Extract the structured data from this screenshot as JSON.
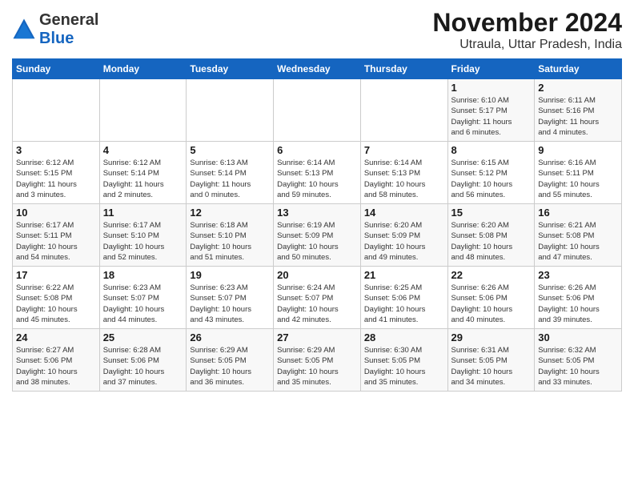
{
  "header": {
    "logo_general": "General",
    "logo_blue": "Blue",
    "month_title": "November 2024",
    "subtitle": "Utraula, Uttar Pradesh, India"
  },
  "calendar": {
    "days_of_week": [
      "Sunday",
      "Monday",
      "Tuesday",
      "Wednesday",
      "Thursday",
      "Friday",
      "Saturday"
    ],
    "weeks": [
      [
        {
          "day": "",
          "info": ""
        },
        {
          "day": "",
          "info": ""
        },
        {
          "day": "",
          "info": ""
        },
        {
          "day": "",
          "info": ""
        },
        {
          "day": "",
          "info": ""
        },
        {
          "day": "1",
          "info": "Sunrise: 6:10 AM\nSunset: 5:17 PM\nDaylight: 11 hours\nand 6 minutes."
        },
        {
          "day": "2",
          "info": "Sunrise: 6:11 AM\nSunset: 5:16 PM\nDaylight: 11 hours\nand 4 minutes."
        }
      ],
      [
        {
          "day": "3",
          "info": "Sunrise: 6:12 AM\nSunset: 5:15 PM\nDaylight: 11 hours\nand 3 minutes."
        },
        {
          "day": "4",
          "info": "Sunrise: 6:12 AM\nSunset: 5:14 PM\nDaylight: 11 hours\nand 2 minutes."
        },
        {
          "day": "5",
          "info": "Sunrise: 6:13 AM\nSunset: 5:14 PM\nDaylight: 11 hours\nand 0 minutes."
        },
        {
          "day": "6",
          "info": "Sunrise: 6:14 AM\nSunset: 5:13 PM\nDaylight: 10 hours\nand 59 minutes."
        },
        {
          "day": "7",
          "info": "Sunrise: 6:14 AM\nSunset: 5:13 PM\nDaylight: 10 hours\nand 58 minutes."
        },
        {
          "day": "8",
          "info": "Sunrise: 6:15 AM\nSunset: 5:12 PM\nDaylight: 10 hours\nand 56 minutes."
        },
        {
          "day": "9",
          "info": "Sunrise: 6:16 AM\nSunset: 5:11 PM\nDaylight: 10 hours\nand 55 minutes."
        }
      ],
      [
        {
          "day": "10",
          "info": "Sunrise: 6:17 AM\nSunset: 5:11 PM\nDaylight: 10 hours\nand 54 minutes."
        },
        {
          "day": "11",
          "info": "Sunrise: 6:17 AM\nSunset: 5:10 PM\nDaylight: 10 hours\nand 52 minutes."
        },
        {
          "day": "12",
          "info": "Sunrise: 6:18 AM\nSunset: 5:10 PM\nDaylight: 10 hours\nand 51 minutes."
        },
        {
          "day": "13",
          "info": "Sunrise: 6:19 AM\nSunset: 5:09 PM\nDaylight: 10 hours\nand 50 minutes."
        },
        {
          "day": "14",
          "info": "Sunrise: 6:20 AM\nSunset: 5:09 PM\nDaylight: 10 hours\nand 49 minutes."
        },
        {
          "day": "15",
          "info": "Sunrise: 6:20 AM\nSunset: 5:08 PM\nDaylight: 10 hours\nand 48 minutes."
        },
        {
          "day": "16",
          "info": "Sunrise: 6:21 AM\nSunset: 5:08 PM\nDaylight: 10 hours\nand 47 minutes."
        }
      ],
      [
        {
          "day": "17",
          "info": "Sunrise: 6:22 AM\nSunset: 5:08 PM\nDaylight: 10 hours\nand 45 minutes."
        },
        {
          "day": "18",
          "info": "Sunrise: 6:23 AM\nSunset: 5:07 PM\nDaylight: 10 hours\nand 44 minutes."
        },
        {
          "day": "19",
          "info": "Sunrise: 6:23 AM\nSunset: 5:07 PM\nDaylight: 10 hours\nand 43 minutes."
        },
        {
          "day": "20",
          "info": "Sunrise: 6:24 AM\nSunset: 5:07 PM\nDaylight: 10 hours\nand 42 minutes."
        },
        {
          "day": "21",
          "info": "Sunrise: 6:25 AM\nSunset: 5:06 PM\nDaylight: 10 hours\nand 41 minutes."
        },
        {
          "day": "22",
          "info": "Sunrise: 6:26 AM\nSunset: 5:06 PM\nDaylight: 10 hours\nand 40 minutes."
        },
        {
          "day": "23",
          "info": "Sunrise: 6:26 AM\nSunset: 5:06 PM\nDaylight: 10 hours\nand 39 minutes."
        }
      ],
      [
        {
          "day": "24",
          "info": "Sunrise: 6:27 AM\nSunset: 5:06 PM\nDaylight: 10 hours\nand 38 minutes."
        },
        {
          "day": "25",
          "info": "Sunrise: 6:28 AM\nSunset: 5:06 PM\nDaylight: 10 hours\nand 37 minutes."
        },
        {
          "day": "26",
          "info": "Sunrise: 6:29 AM\nSunset: 5:05 PM\nDaylight: 10 hours\nand 36 minutes."
        },
        {
          "day": "27",
          "info": "Sunrise: 6:29 AM\nSunset: 5:05 PM\nDaylight: 10 hours\nand 35 minutes."
        },
        {
          "day": "28",
          "info": "Sunrise: 6:30 AM\nSunset: 5:05 PM\nDaylight: 10 hours\nand 35 minutes."
        },
        {
          "day": "29",
          "info": "Sunrise: 6:31 AM\nSunset: 5:05 PM\nDaylight: 10 hours\nand 34 minutes."
        },
        {
          "day": "30",
          "info": "Sunrise: 6:32 AM\nSunset: 5:05 PM\nDaylight: 10 hours\nand 33 minutes."
        }
      ]
    ]
  }
}
